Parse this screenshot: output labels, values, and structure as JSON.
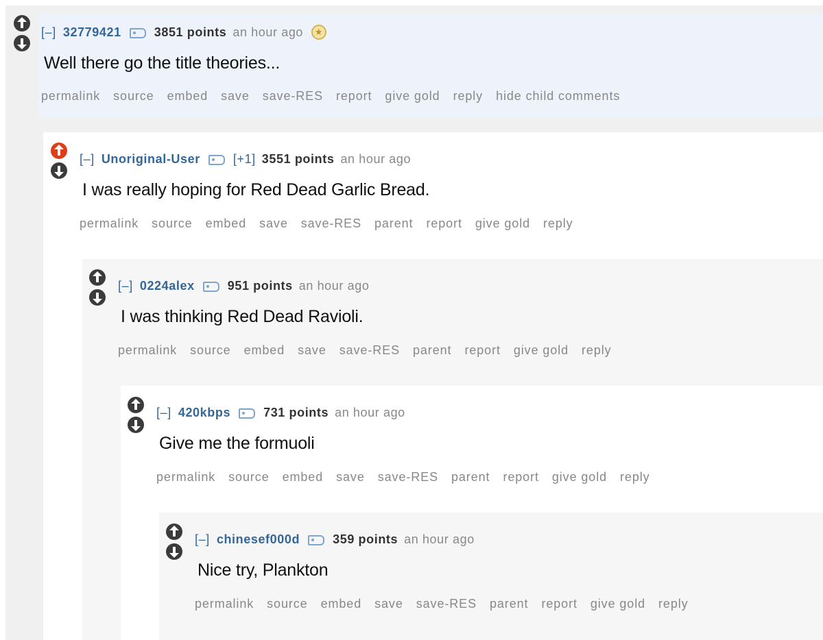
{
  "comments": [
    {
      "collapse": "[–]",
      "author": "32779421",
      "flair": "",
      "score": "3851 points",
      "time": "an hour ago",
      "gilded_icon": "gold-star-icon",
      "body": "Well there go the title theories...",
      "upvoted": false,
      "buttons": [
        "permalink",
        "source",
        "embed",
        "save",
        "save-RES",
        "report",
        "give gold",
        "reply",
        "hide child comments"
      ]
    },
    {
      "collapse": "[–]",
      "author": "Unoriginal-User",
      "flair": "[+1]",
      "score": "3551 points",
      "time": "an hour ago",
      "body": "I was really hoping for Red Dead Garlic Bread.",
      "upvoted": true,
      "buttons": [
        "permalink",
        "source",
        "embed",
        "save",
        "save-RES",
        "parent",
        "report",
        "give gold",
        "reply"
      ]
    },
    {
      "collapse": "[–]",
      "author": "0224alex",
      "flair": "",
      "score": "951 points",
      "time": "an hour ago",
      "body": "I was thinking Red Dead Ravioli.",
      "upvoted": false,
      "buttons": [
        "permalink",
        "source",
        "embed",
        "save",
        "save-RES",
        "parent",
        "report",
        "give gold",
        "reply"
      ]
    },
    {
      "collapse": "[–]",
      "author": "420kbps",
      "flair": "",
      "score": "731 points",
      "time": "an hour ago",
      "body": "Give me the formuoli",
      "upvoted": false,
      "buttons": [
        "permalink",
        "source",
        "embed",
        "save",
        "save-RES",
        "parent",
        "report",
        "give gold",
        "reply"
      ]
    },
    {
      "collapse": "[–]",
      "author": "chinesef000d",
      "flair": "",
      "score": "359 points",
      "time": "an hour ago",
      "body": "Nice try, Plankton",
      "upvoted": false,
      "buttons": [
        "permalink",
        "source",
        "embed",
        "save",
        "save-RES",
        "parent",
        "report",
        "give gold",
        "reply"
      ]
    }
  ],
  "colors": {
    "author_link": "#336699",
    "upvote_active": "#e03c17",
    "vote_default": "#3b3b3b",
    "button_text": "#888888"
  }
}
